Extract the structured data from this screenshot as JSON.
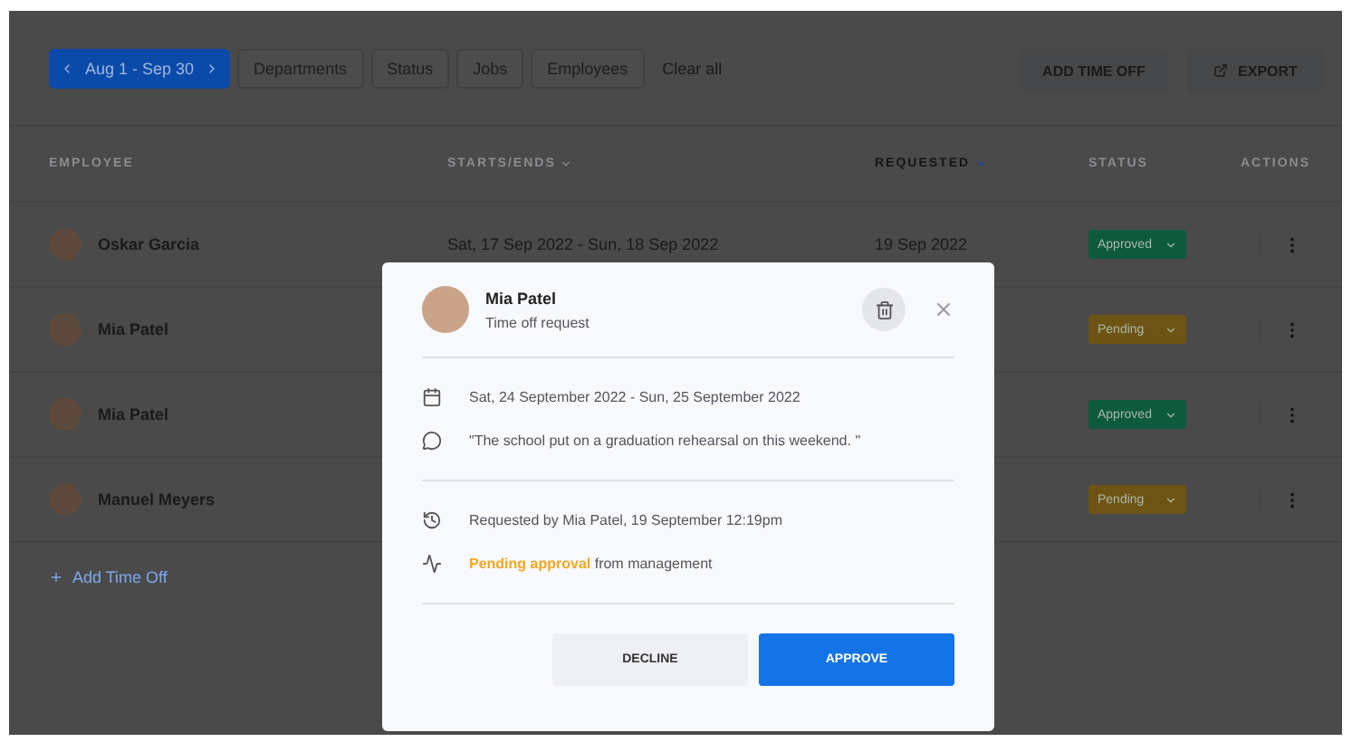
{
  "toolbar": {
    "date_range": "Aug 1 - Sep 30",
    "filters": [
      "Departments",
      "Status",
      "Jobs",
      "Employees"
    ],
    "clear": "Clear all",
    "add_button": "ADD TIME OFF",
    "export_button": "EXPORT"
  },
  "table": {
    "columns": [
      {
        "label": "EMPLOYEE",
        "sorted": false
      },
      {
        "label": "STARTS/ENDS",
        "sorted": true
      },
      {
        "label": "REQUESTED",
        "sorted": true
      },
      {
        "label": "STATUS",
        "sorted": false
      },
      {
        "label": "ACTIONS",
        "sorted": false
      }
    ],
    "rows": [
      {
        "employee": "Oskar Garcia",
        "dates": "Sat, 17 Sep 2022 - Sun, 18 Sep 2022",
        "requested": "19 Sep 2022",
        "status": "Approved",
        "color": "#0e5a3e"
      },
      {
        "employee": "Mia Patel",
        "status": "Pending",
        "color": "#6e5414"
      },
      {
        "employee": "Mia Patel",
        "status": "Approved",
        "color": "#0e5a3e"
      },
      {
        "employee": "Manuel Meyers",
        "status": "Pending",
        "color": "#6e5414"
      }
    ],
    "add_link": "Add Time Off"
  },
  "modal": {
    "name": "Mia Patel",
    "subtitle": "Time off request",
    "dates": "Sat, 24 September 2022 - Sun, 25 September 2022",
    "note": "\"The school put on a graduation rehearsal on this weekend. \"",
    "requested_by": "Requested by Mia Patel, 19 September 12:19pm",
    "status": "**Pending approval** from management",
    "decline": "DECLINE",
    "approve": "APPROVE"
  }
}
